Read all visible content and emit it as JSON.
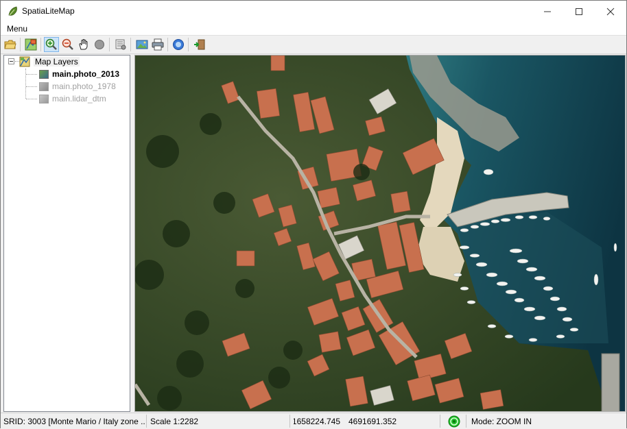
{
  "window": {
    "title": "SpatiaLiteMap",
    "minimize": "—",
    "maximize": "☐",
    "close": "✕"
  },
  "menu": {
    "label": "Menu"
  },
  "toolbar": {
    "buttons": [
      {
        "icon": "open-folder-icon"
      },
      {
        "icon": "add-layer-icon"
      },
      {
        "icon": "zoom-in-icon",
        "active": true
      },
      {
        "icon": "zoom-out-icon"
      },
      {
        "icon": "pan-hand-icon"
      },
      {
        "icon": "identify-icon"
      },
      {
        "icon": "properties-icon"
      },
      {
        "icon": "export-image-icon"
      },
      {
        "icon": "print-icon"
      },
      {
        "icon": "about-icon"
      },
      {
        "icon": "exit-icon"
      }
    ]
  },
  "tree": {
    "root_label": "Map Layers",
    "layers": [
      {
        "name": "main.photo_2013",
        "enabled": true
      },
      {
        "name": "main.photo_1978",
        "enabled": false
      },
      {
        "name": "main.lidar_dtm",
        "enabled": false
      }
    ]
  },
  "status": {
    "srid": "SRID: 3003 [Monte Mario / Italy zone ...",
    "scale": "Scale 1:2282",
    "x": "1658224.745",
    "y": "4691691.352",
    "mode": "Mode: ZOOM IN"
  },
  "colors": {
    "sea_deep": "#0e3a4a",
    "sea_shallow": "#2f7a80",
    "vegetation": "#2e4a22",
    "roof": "#c8704e",
    "sand": "#e4d8bd",
    "status_ok": "#22c02a"
  }
}
